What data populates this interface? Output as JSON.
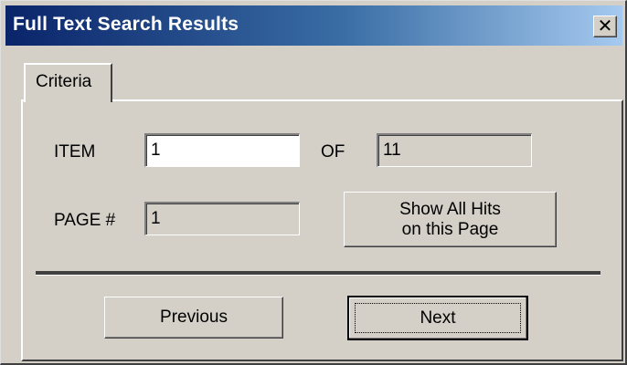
{
  "window": {
    "title": "Full Text Search Results",
    "close_label": "✕"
  },
  "tabs": [
    {
      "label": "Criteria",
      "selected": true
    }
  ],
  "criteria": {
    "item_label": "ITEM",
    "item_value": "1",
    "of_label": "OF",
    "of_value": "11",
    "page_label": "PAGE #",
    "page_value": "1"
  },
  "buttons": {
    "show_all_hits": "Show All Hits\non this Page",
    "previous": "Previous",
    "next": "Next"
  },
  "colors": {
    "titlebar_start": "#0a246a",
    "titlebar_end": "#a6caf0",
    "face": "#d4d0c8"
  },
  "icons": {
    "close": "close-icon"
  }
}
